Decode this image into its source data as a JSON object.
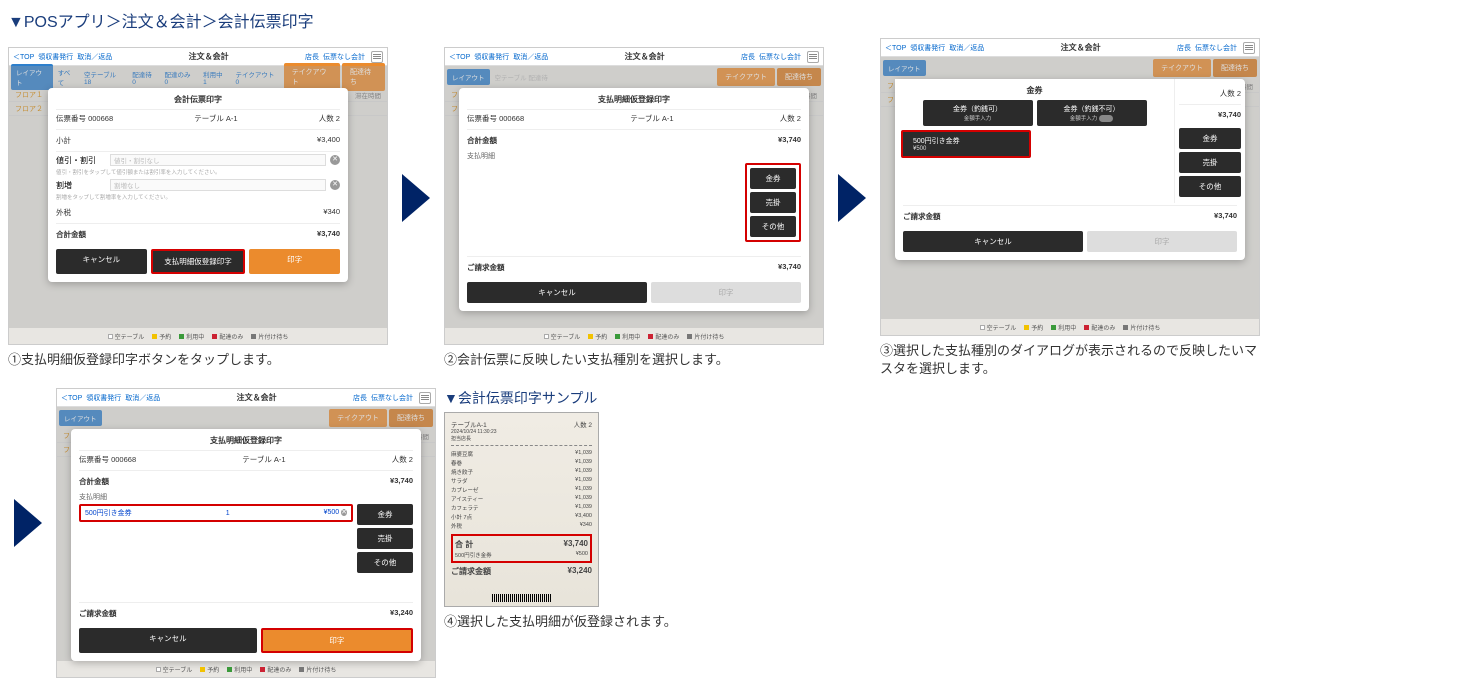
{
  "main_title": "▼POSアプリ＞注文＆会計＞会計伝票印字",
  "topbar": {
    "top": "＜TOP",
    "receipt": "領収書発行",
    "cancel_return": "取消／返品",
    "center": "注文＆会計",
    "shop": "店長",
    "no_slip_pay": "伝票なし会計"
  },
  "tabs": {
    "layout": "レイアウト",
    "all": "すべて",
    "empty": "空テーブル\n18",
    "delivery": "配達待\n0",
    "delivery_only": "配達のみ\n0",
    "use": "利用中\n1",
    "takeout": "テイクアウト\n0",
    "takeout_tab": "テイクアウト",
    "delivery_tab": "配達待ち"
  },
  "floors": {
    "f1": "フロア１",
    "f2": "フロア２",
    "waiting": "滞在時間"
  },
  "legend": {
    "empty": "空テーブル",
    "reserved": "予約",
    "inuse": "利用中",
    "delivery_only": "配達のみ",
    "cleaning": "片付け待ち"
  },
  "dlg1": {
    "title": "会計伝票印字",
    "slip_no_label": "伝票番号 000668",
    "table": "テーブル A-1",
    "persons": "人数 2",
    "subtotal_label": "小計",
    "subtotal": "¥3,400",
    "discount_label": "値引・割引",
    "discount_input_placeholder": "値引・割引なし",
    "discount_hint": "値引・割引をタップして値引額または割引率を入力してください。",
    "fee_label": "割増",
    "fee_input_placeholder": "割増なし",
    "fee_hint": "割増をタップして割増率を入力してください。",
    "tax_label": "外税",
    "tax": "¥340",
    "total_label": "合計金額",
    "total": "¥3,740",
    "btn_cancel": "キャンセル",
    "btn_preregister": "支払明細仮登録印字",
    "btn_print": "印字"
  },
  "caption1": "①支払明細仮登録印字ボタンをタップします。",
  "dlg2": {
    "title": "支払明細仮登録印字",
    "slip_no_label": "伝票番号 000668",
    "table": "テーブル A-1",
    "persons": "人数 2",
    "total_label": "合計金額",
    "total": "¥3,740",
    "detail_label": "支払明細",
    "btn_voucher": "金券",
    "btn_credit": "売掛",
    "btn_other": "その他",
    "request_label": "ご請求金額",
    "request": "¥3,740",
    "btn_cancel": "キャンセル",
    "btn_print": "印字"
  },
  "caption2": "②会計伝票に反映したい支払種別を選択します。",
  "dlg3": {
    "title": "金券",
    "btn1": "金券（釣銭可）",
    "btn1_sub": "金額手入力",
    "btn2": "金券（釣銭不可）",
    "btn2_sub": "金額手入力",
    "item1": "500円引き金券",
    "item1_amt": "¥500",
    "persons": "人数 2",
    "total": "¥3,740",
    "btn_voucher": "金券",
    "btn_credit": "売掛",
    "btn_other": "その他",
    "request_label": "ご請求金額",
    "request": "¥3,740",
    "btn_cancel": "キャンセル",
    "btn_print": "印字"
  },
  "caption3": "③選択した支払種別のダイアログが表示されるので反映したいマスタを選択します。",
  "dlg4": {
    "title": "支払明細仮登録印字",
    "slip_no_label": "伝票番号 000668",
    "table": "テーブル A-1",
    "persons": "人数 2",
    "total_label": "合計金額",
    "total": "¥3,740",
    "detail_label": "支払明細",
    "item_name": "500円引き金券",
    "item_qty": "1",
    "item_amt": "¥500",
    "btn_voucher": "金券",
    "btn_credit": "売掛",
    "btn_other": "その他",
    "request_label": "ご請求金額",
    "request": "¥3,240",
    "btn_cancel": "キャンセル",
    "btn_print": "印字"
  },
  "caption4": "④選択した支払明細が仮登録されます。",
  "sample_title": "▼会計伝票印字サンプル",
  "receipt": {
    "table": "テーブルA-1",
    "persons": "人数 2",
    "date": "2024/10/24 11:30:23",
    "cashier": "担当店長",
    "items": [
      {
        "n": "麻婆豆腐",
        "p": "¥1,039"
      },
      {
        "n": "春巻",
        "p": "¥1,039"
      },
      {
        "n": "焼き餃子",
        "p": "¥1,039"
      },
      {
        "n": "サラダ",
        "p": "¥1,039"
      },
      {
        "n": "カプレーゼ",
        "p": "¥1,039"
      },
      {
        "n": "アイスティー",
        "p": "¥1,039"
      },
      {
        "n": "カフェラテ",
        "p": "¥1,039"
      }
    ],
    "subtotal_label": "小計 7点",
    "subtotal": "¥3,400",
    "tax_label": "外税",
    "tax": "¥340",
    "total_label": "合 計",
    "total": "¥3,740",
    "voucher_label": "500円引き金券",
    "voucher": "¥500",
    "request_label": "ご請求金額",
    "request": "¥3,240"
  }
}
